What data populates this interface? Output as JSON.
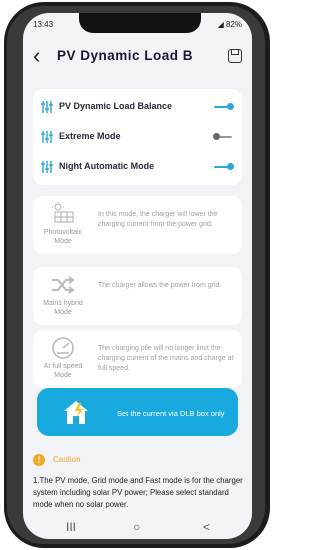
{
  "status_bar": {
    "time": "13:43",
    "left_icons": "▣ •",
    "right_text": "82%"
  },
  "header": {
    "title": "PV Dynamic Load B",
    "back_icon": "chevron-left-icon",
    "save_icon": "save-icon"
  },
  "settings": [
    {
      "label": "PV Dynamic Load Balance",
      "enabled": true
    },
    {
      "label": "Extreme Mode",
      "enabled": false
    },
    {
      "label": "Night Automatic Mode",
      "enabled": true
    }
  ],
  "modes": [
    {
      "name": "Photovoltaic Mode",
      "description": "In this mode, the charger will lower the charging current from the power grid.",
      "icon": "solar-panel-icon"
    },
    {
      "name": "Mains hybrid Mode",
      "description": "The charger allows the power from grid.",
      "icon": "shuffle-icon"
    },
    {
      "name": "At full speed Mode",
      "description": "The charging pile will no longer limit the charging current of the mains and charge at full speed.",
      "icon": "speedometer-icon"
    }
  ],
  "dlb_button": {
    "label": "Set the current via DLB box only",
    "icon": "home-lightning-icon"
  },
  "caution": {
    "title": "Caution",
    "text": "1.The PV mode, Grid mode and Fast mode is for the charger system including solar PV power; Please select standard mode when no solar power."
  },
  "nav": {
    "recents": "III",
    "home": "○",
    "back": "<"
  },
  "colors": {
    "accent": "#18a9de",
    "toggle_on": "#2aa8d6",
    "caution": "#f5a623"
  }
}
